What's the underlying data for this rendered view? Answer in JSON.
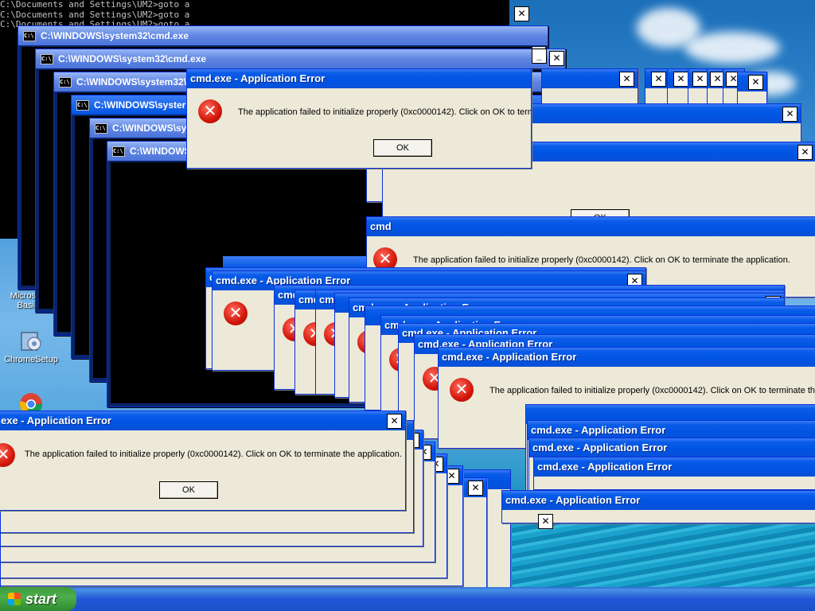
{
  "desktop": {
    "icons": [
      {
        "label": "Microsoft Basic",
        "icon": "app-icon"
      },
      {
        "label": "ChromeSetup",
        "icon": "setup-icon"
      },
      {
        "label": "",
        "icon": "chrome-icon"
      }
    ]
  },
  "console": {
    "lines": [
      "C:\\Documents and Settings\\UM2>goto a",
      "C:\\Documents and Settings\\UM2>goto a",
      "C:\\Documents and Settings\\UM2>goto a"
    ],
    "prompt_stub": "C:"
  },
  "cmd_window": {
    "title": "C:\\WINDOWS\\system32\\cmd.exe",
    "title_partial": "C:\\WINDOWS\\syster",
    "icon": "cmd-icon"
  },
  "error_dialog": {
    "title": "cmd.exe - Application Error",
    "title_partial": "cmd",
    "title_cut": "exe - Application Error",
    "message": "The application failed to initialize properly (0xc0000142). Click on OK to terminate the application.",
    "message_cut": "The application failed to initialize properly (0xc0000142). Click on OK to terminate the",
    "ok_label": "OK",
    "close_glyph": "✕",
    "icon": "error-icon"
  },
  "taskbar": {
    "start_label": "start"
  },
  "colors": {
    "titlebar_blue": "#0054e3",
    "dialog_face": "#ece9d8",
    "error_red": "#d2160a",
    "start_green": "#3c9a3c"
  }
}
